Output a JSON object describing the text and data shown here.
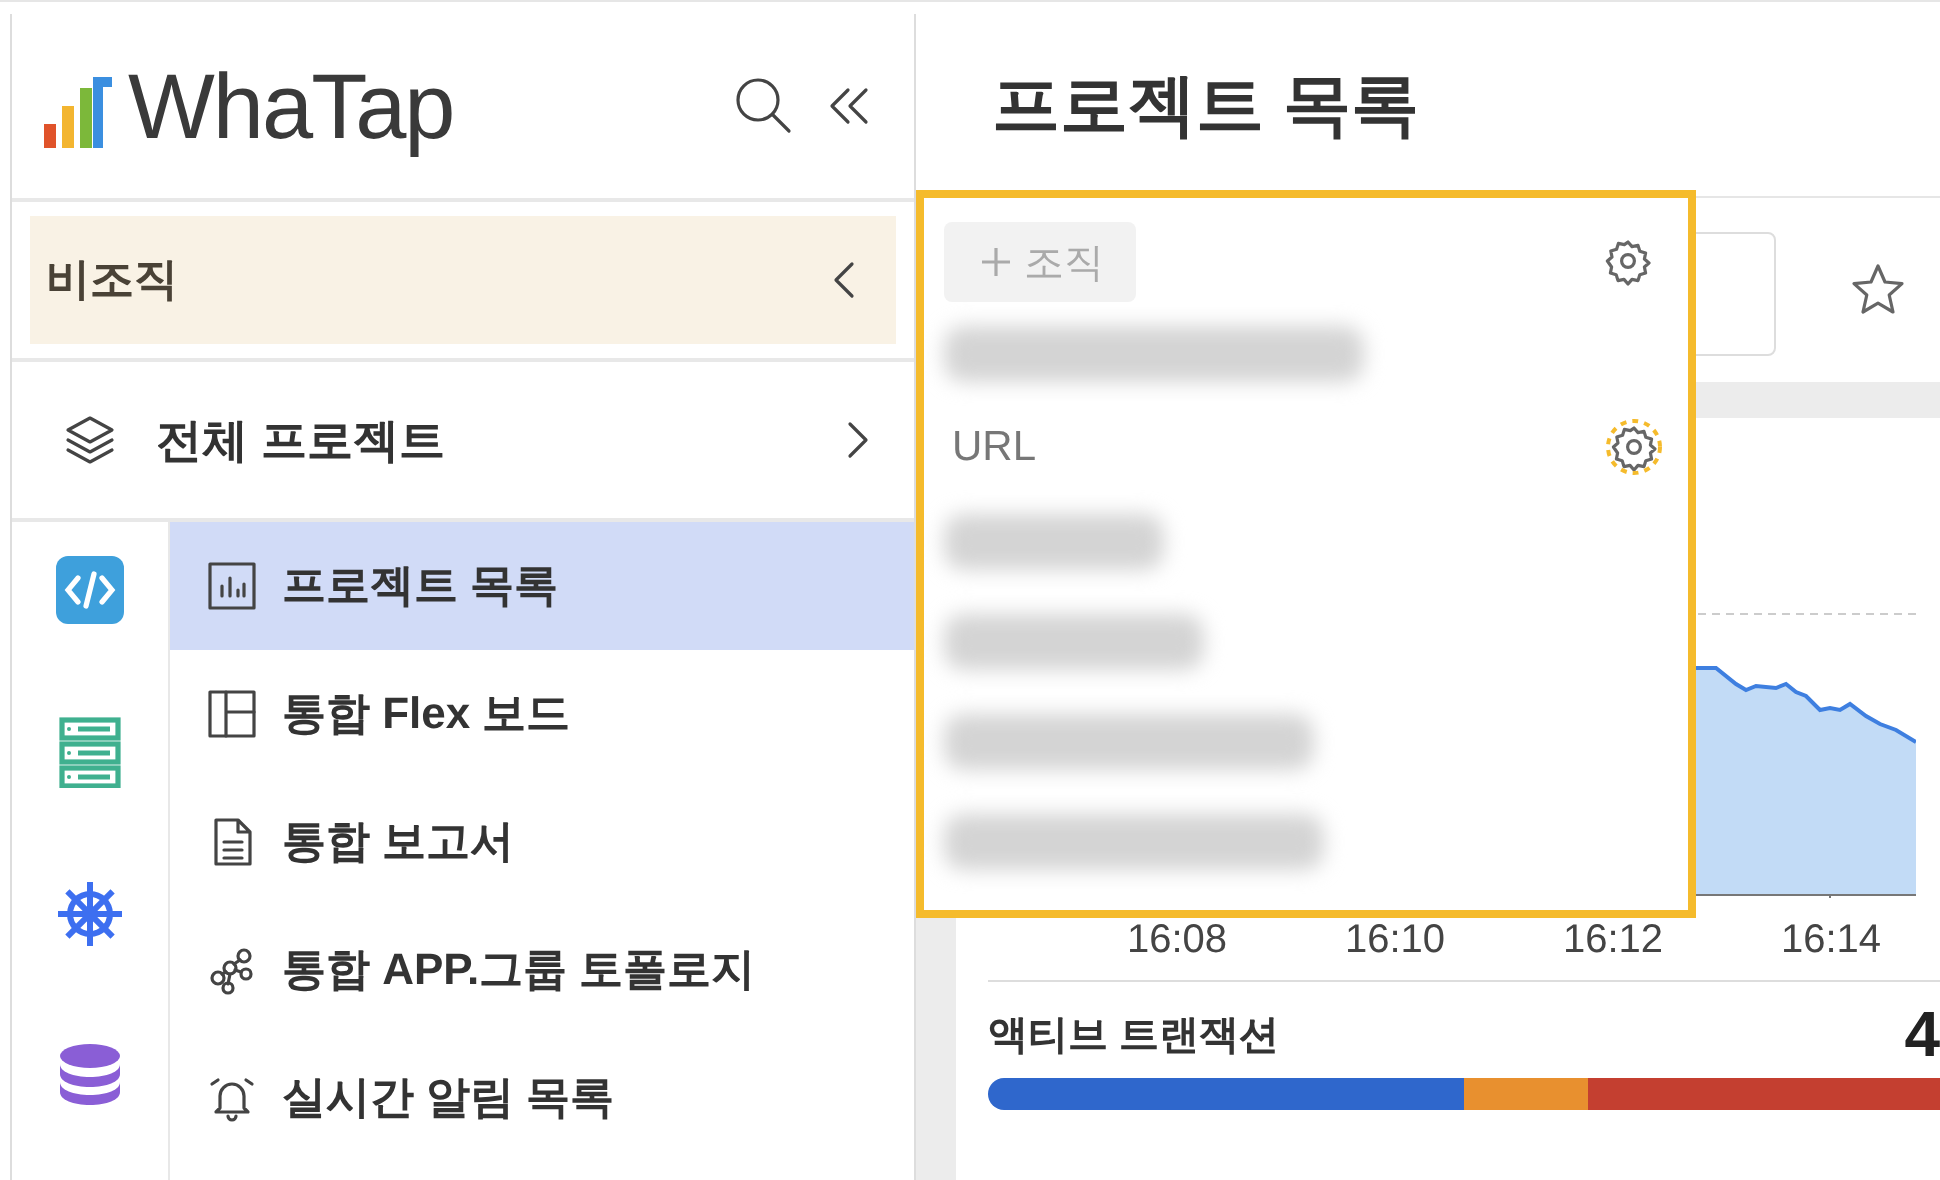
{
  "sidebar": {
    "logo": "WhaTap",
    "organization": {
      "label": "비조직"
    },
    "all_projects": {
      "label": "전체 프로젝트"
    },
    "categories": [
      {
        "kind": "code"
      },
      {
        "kind": "server"
      },
      {
        "kind": "kubernetes"
      },
      {
        "kind": "database"
      }
    ],
    "menu": [
      {
        "label": "프로젝트 목록",
        "selected": true
      },
      {
        "label": "통합 Flex 보드",
        "selected": false
      },
      {
        "label": "통합 보고서",
        "selected": false
      },
      {
        "label": "통합 APP.그룹 토폴로지",
        "selected": false
      },
      {
        "label": "실시간 알림 목록",
        "selected": false
      }
    ]
  },
  "main": {
    "title": "프로젝트 목록",
    "chart": {
      "x_labels": [
        "16:08",
        "16:10",
        "16:12",
        "16:14"
      ]
    },
    "active_transactions": {
      "label": "액티브 트랜잭션",
      "value": "4",
      "segments": [
        {
          "color": "#2f67cc"
        },
        {
          "color": "#e8902f"
        },
        {
          "color": "#c43f30"
        }
      ]
    }
  },
  "popup": {
    "add_button": "조직",
    "items": [
      {
        "kind": "blurred"
      },
      {
        "kind": "label",
        "text": "URL",
        "highlighted": true
      },
      {
        "kind": "blurred"
      },
      {
        "kind": "blurred"
      },
      {
        "kind": "blurred"
      },
      {
        "kind": "blurred"
      }
    ]
  }
}
